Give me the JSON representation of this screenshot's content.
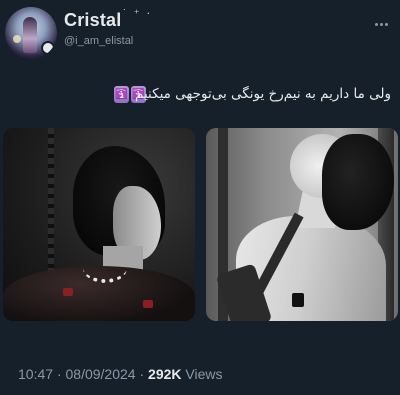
{
  "author": {
    "display_name": "Cristal",
    "name_decoration": "˙ ⁺ ‧",
    "handle": "@i_am_elistal",
    "avatar_icon": "profile-avatar"
  },
  "more_icon": "ellipsis-icon",
  "tweet": {
    "text": "ولی ما داریم به نیم‌رخ یونگی بی‌توجهی میکنیم",
    "emoji": [
      "🛐",
      "🛐"
    ]
  },
  "media": [
    {
      "kind": "photo",
      "description_icon": "photo-left"
    },
    {
      "kind": "photo",
      "description_icon": "photo-right"
    }
  ],
  "meta": {
    "time": "10:47",
    "separator": "·",
    "date": "08/09/2024",
    "views_count": "292K",
    "views_label": "Views"
  },
  "colors": {
    "background": "#15202b",
    "primary_text": "#e7e9ea",
    "secondary_text": "#8b98a5"
  }
}
